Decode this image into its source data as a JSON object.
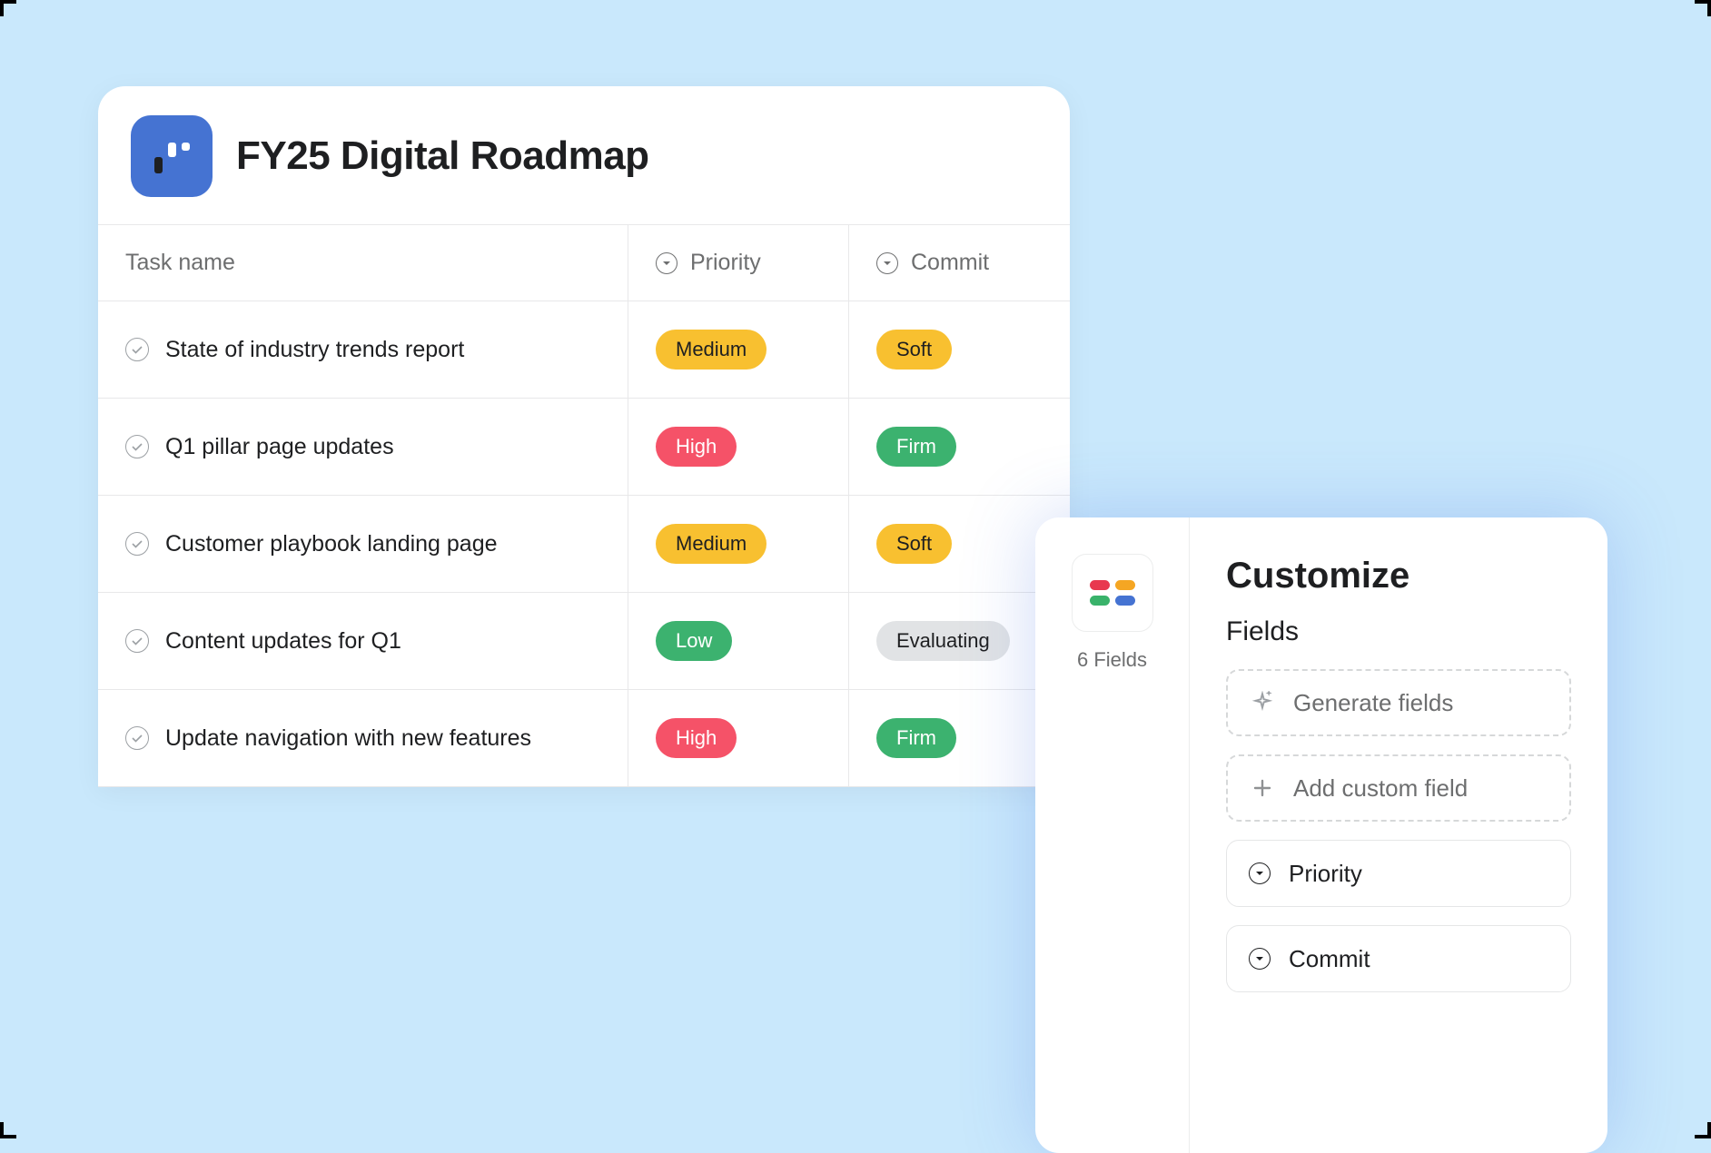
{
  "project": {
    "title": "FY25 Digital Roadmap"
  },
  "columns": {
    "task": "Task name",
    "priority": "Priority",
    "commit": "Commit"
  },
  "rows": [
    {
      "task": "State of industry trends report",
      "priority": {
        "label": "Medium",
        "color": "yellow"
      },
      "commit": {
        "label": "Soft",
        "color": "yellow"
      }
    },
    {
      "task": "Q1 pillar page updates",
      "priority": {
        "label": "High",
        "color": "red"
      },
      "commit": {
        "label": "Firm",
        "color": "green"
      }
    },
    {
      "task": "Customer playbook landing page",
      "priority": {
        "label": "Medium",
        "color": "yellow"
      },
      "commit": {
        "label": "Soft",
        "color": "yellow"
      }
    },
    {
      "task": "Content updates for Q1",
      "priority": {
        "label": "Low",
        "color": "green"
      },
      "commit": {
        "label": "Evaluating",
        "color": "gray"
      }
    },
    {
      "task": "Update navigation with new features",
      "priority": {
        "label": "High",
        "color": "red"
      },
      "commit": {
        "label": "Firm",
        "color": "green"
      }
    }
  ],
  "customize": {
    "title": "Customize",
    "sidebar_label": "6 Fields",
    "fields_heading": "Fields",
    "generate_label": "Generate fields",
    "add_label": "Add custom field",
    "field_items": [
      {
        "label": "Priority"
      },
      {
        "label": "Commit"
      }
    ]
  },
  "badge_colors": {
    "yellow": "#f8c030",
    "red": "#f55268",
    "green": "#3cb26f",
    "gray": "#e1e3e5"
  }
}
